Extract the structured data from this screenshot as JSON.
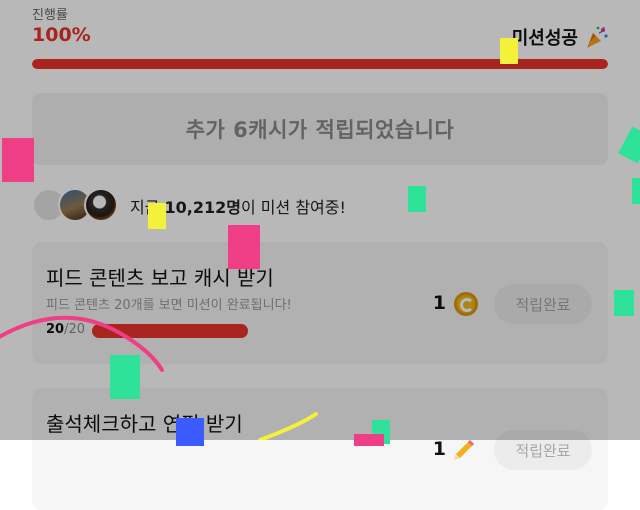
{
  "progress": {
    "label": "진행률",
    "value": "100%",
    "percent": 100,
    "status": "미션성공",
    "status_icon": "party-popper-icon",
    "accent_color": "#e8322b"
  },
  "reward_banner": {
    "text": "추가 6캐시가 적립되었습니다"
  },
  "participants": {
    "prefix": "지금 ",
    "count": "10,212명",
    "suffix": "이 미션 참여중!"
  },
  "tasks": [
    {
      "title": "피드 콘텐츠 보고 캐시 받기",
      "description": "피드 콘텐츠 20개를 보면 미션이 완료됩니다!",
      "done": "20",
      "total": "/20",
      "progress_fraction": 1.0,
      "reward": "1",
      "reward_icon": "coin-icon",
      "button": "적립완료"
    },
    {
      "title": "출석체크하고 연필 받기",
      "reward": "1",
      "reward_icon": "pencil-icon",
      "button": "적립완료"
    }
  ]
}
